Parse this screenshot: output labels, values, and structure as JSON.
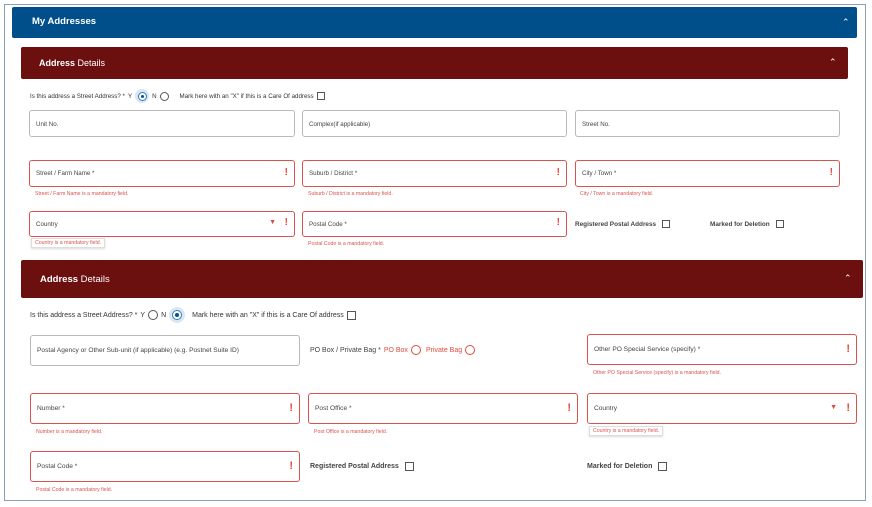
{
  "header": {
    "title": "My Addresses"
  },
  "section1": {
    "title_bold": "Address",
    "title_rest": " Details",
    "street_question": "Is this address a Street Address? *",
    "yes": "Y",
    "no": "N",
    "care_of": "Mark here with an \"X\" if this is a Care Of address",
    "unit_no": "Unit No.",
    "complex": "Complex(if applicable)",
    "street_no": "Street No.",
    "street_name": "Street / Farm Name *",
    "street_name_err": "Street / Farm Name is a mandatory field.",
    "suburb": "Suburb / District *",
    "suburb_err": "Suburb / District is a mandatory field.",
    "city": "City / Town *",
    "city_err": "City / Town is a mandatory field.",
    "country": "Country",
    "country_err": "Country is a mandatory field.",
    "postal_code": "Postal Code *",
    "postal_code_err": "Postal Code is a mandatory field.",
    "registered": "Registered Postal Address",
    "deletion": "Marked for Deletion"
  },
  "section2": {
    "title_bold": "Address",
    "title_rest": " Details",
    "street_question": "Is this address a Street Address? *",
    "yes": "Y",
    "no": "N",
    "care_of": "Mark here with an \"X\" if this is a Care Of address",
    "postal_agency": "Postal Agency or Other Sub-unit (if applicable) (e.g. Postnet Suite ID)",
    "po_box_label": "PO Box / Private Bag *",
    "po_box": "PO Box",
    "private_bag": "Private Bag",
    "other_po": "Other PO Special Service (specify) *",
    "other_po_err": "Other PO Special Service (specify) is a mandatory field.",
    "number": "Number *",
    "number_err": "Number is a mandatory field.",
    "post_office": "Post Office *",
    "post_office_err": "Post Office is a mandatory field.",
    "country": "Country",
    "country_err": "Country is a mandatory field.",
    "postal_code": "Postal Code *",
    "postal_code_err": "Postal Code is a mandatory field.",
    "registered": "Registered Postal Address",
    "deletion": "Marked for Deletion"
  },
  "icons": {
    "collapse": "chevron-up-icon",
    "error": "exclamation-icon",
    "dropdown": "caret-down-icon"
  },
  "colors": {
    "header_blue": "#004f8b",
    "band_maroon": "#6b0f0f",
    "error_red": "#d9534f",
    "radio_selected": "#0d4d8a"
  }
}
